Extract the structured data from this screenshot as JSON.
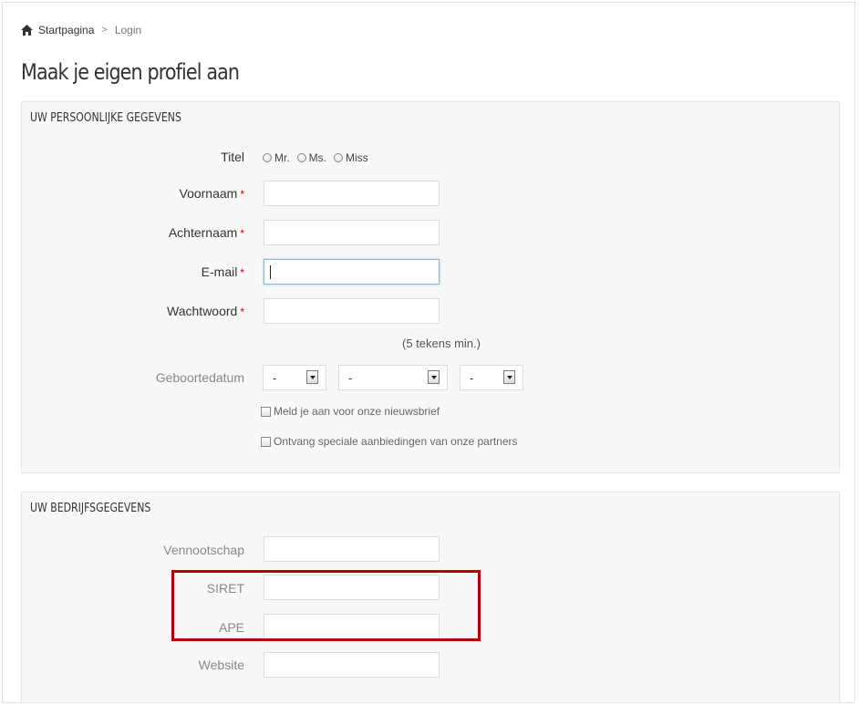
{
  "breadcrumb": {
    "home_label": "Startpagina",
    "separator": ">",
    "current": "Login"
  },
  "page_title": "Maak je eigen profiel aan",
  "personal": {
    "legend": "UW PERSOONLIJKE GEGEVENS",
    "title_label": "Titel",
    "title_options": [
      "Mr.",
      "Ms.",
      "Miss"
    ],
    "first_name_label": "Voornaam",
    "last_name_label": "Achternaam",
    "email_label": "E-mail",
    "password_label": "Wachtwoord",
    "required_mark": "*",
    "password_hint": "(5 tekens min.)",
    "birthdate_label": "Geboortedatum",
    "birthdate_day": "-",
    "birthdate_month": "-",
    "birthdate_year": "-",
    "newsletter_label": "Meld je aan voor onze nieuwsbrief",
    "partners_label": "Ontvang speciale aanbiedingen van onze partners"
  },
  "company": {
    "legend": "UW BEDRIJFSGEGEVENS",
    "company_label": "Vennootschap",
    "siret_label": "SIRET",
    "ape_label": "APE",
    "website_label": "Website"
  },
  "colors": {
    "required": "#cc0000",
    "highlight": "#b30000",
    "focus_border": "#8cb4dc"
  },
  "icons": {
    "home": "home-icon",
    "select_arrow": "chevron-down-icon"
  }
}
